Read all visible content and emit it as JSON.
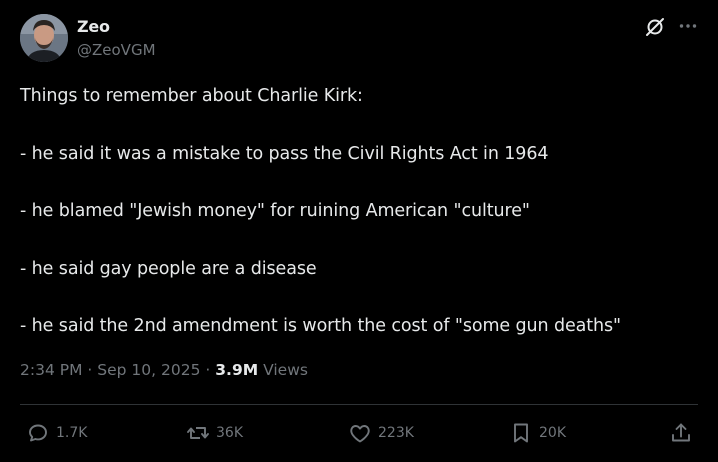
{
  "author": {
    "name": "Zeo",
    "handle": "@ZeoVGM"
  },
  "icons": {
    "header": [
      "grok-icon",
      "more-icon"
    ],
    "actions": [
      "reply-icon",
      "retweet-icon",
      "like-icon",
      "bookmark-icon",
      "share-icon"
    ]
  },
  "post": {
    "text": "Things to remember about Charlie Kirk:\n\n- he said it was a mistake to pass the Civil Rights Act in 1964\n\n- he blamed \"Jewish money\" for ruining American \"culture\"\n\n- he said gay people are a disease\n\n- he said the 2nd amendment is worth the cost of \"some gun deaths\"",
    "time": "2:34 PM",
    "date": "Sep 10, 2025",
    "separator": "·",
    "views_count": "3.9M",
    "views_label": "Views"
  },
  "actions": {
    "replies": "1.7K",
    "reposts": "36K",
    "likes": "223K",
    "bookmarks": "20K"
  },
  "colors": {
    "background": "#000000",
    "text_primary": "#e7e9ea",
    "text_secondary": "#71767b",
    "divider": "#2f3336"
  }
}
